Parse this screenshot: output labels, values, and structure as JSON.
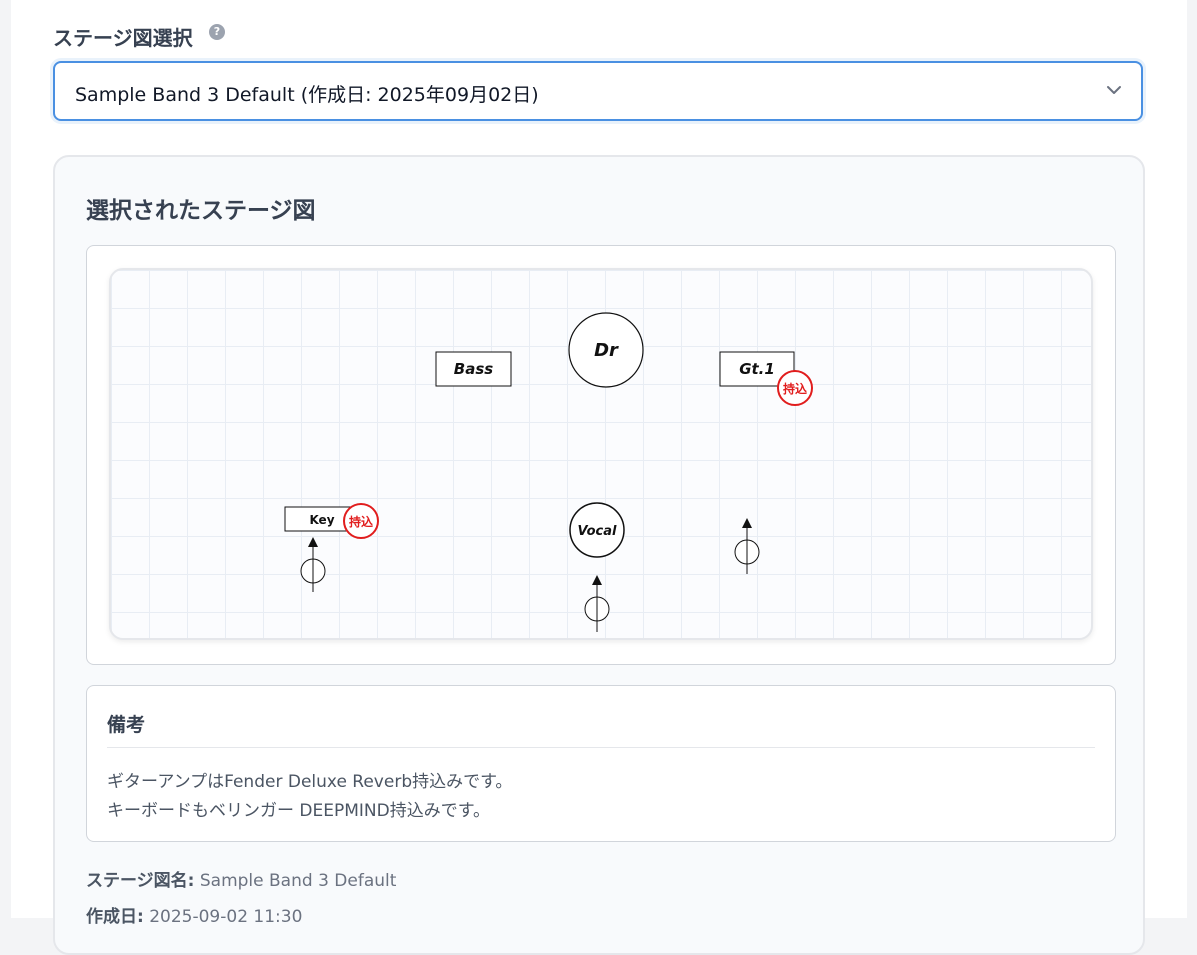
{
  "field": {
    "label": "ステージ図選択",
    "help_icon": "question-circle-icon",
    "help_glyph": "?"
  },
  "select": {
    "value": "Sample Band 3 Default (作成日: 2025年09月02日)",
    "icon": "chevron-down-icon"
  },
  "panel": {
    "title": "選択されたステージ図"
  },
  "stage": {
    "items": [
      {
        "name": "stage-item-bass",
        "label": "Bass",
        "shape": "rect"
      },
      {
        "name": "stage-item-drums",
        "label": "Dr",
        "shape": "circle"
      },
      {
        "name": "stage-item-guitar1",
        "label": "Gt.1",
        "shape": "rect",
        "badge": "持込"
      },
      {
        "name": "stage-item-keyboard",
        "label": "Key",
        "shape": "rect",
        "badge": "持込"
      },
      {
        "name": "stage-item-vocal",
        "label": "Vocal",
        "shape": "circle"
      }
    ],
    "microphones": 3,
    "colors": {
      "grid": "#e8edf4",
      "badge": "#e11d1d",
      "outline": "#111111"
    }
  },
  "notes": {
    "title": "備考",
    "lines": [
      "ギターアンプはFender Deluxe Reverb持込みです。",
      "キーボードもベリンガー DEEPMIND持込みです。"
    ]
  },
  "meta": {
    "name_label": "ステージ図名:",
    "name_value": "Sample Band 3 Default",
    "date_label": "作成日:",
    "date_value": "2025-09-02 11:30"
  },
  "colors": {
    "accent": "#4a90e2",
    "panel_bg": "#f8fafc",
    "text": "#374151"
  }
}
